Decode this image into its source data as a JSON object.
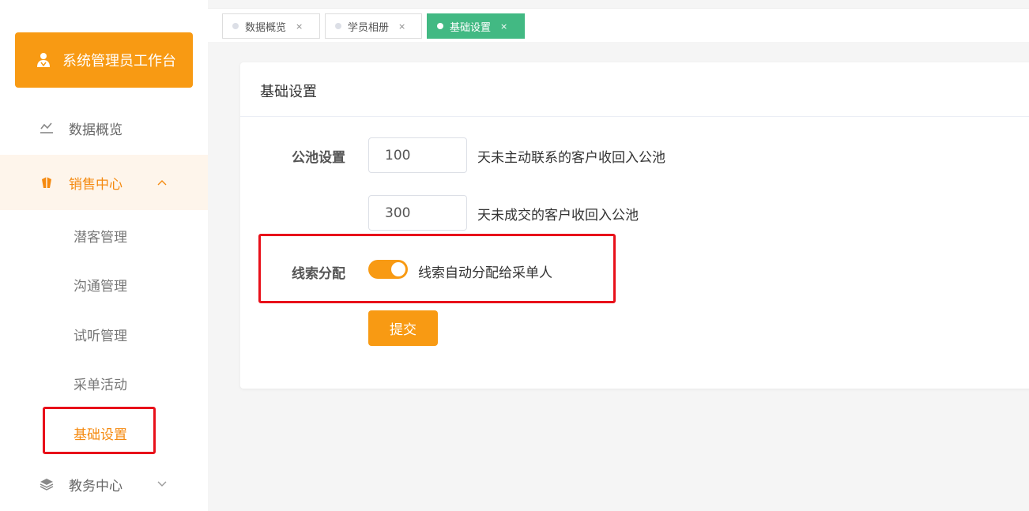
{
  "sidebar": {
    "workbench_label": "系统管理员工作台",
    "items": [
      {
        "label": "数据概览",
        "icon": "chart-line-icon"
      },
      {
        "label": "销售中心",
        "icon": "bag-icon"
      },
      {
        "label": "教务中心",
        "icon": "layers-icon"
      }
    ],
    "sales_subitems": [
      {
        "label": "潜客管理"
      },
      {
        "label": "沟通管理"
      },
      {
        "label": "试听管理"
      },
      {
        "label": "采单活动"
      },
      {
        "label": "基础设置"
      }
    ]
  },
  "tabs": [
    {
      "label": "数据概览",
      "close": "×"
    },
    {
      "label": "学员相册",
      "close": "×"
    },
    {
      "label": "基础设置",
      "close": "×"
    }
  ],
  "card": {
    "title": "基础设置",
    "pool_label": "公池设置",
    "pool_days_1": "100",
    "pool_suffix_1": "天未主动联系的客户收回入公池",
    "pool_days_2": "300",
    "pool_suffix_2": "天未成交的客户收回入公池",
    "lead_label": "线索分配",
    "lead_switch_on": true,
    "lead_desc": "线索自动分配给采单人",
    "submit_label": "提交"
  },
  "colors": {
    "accent": "#f89a13",
    "active_tab": "#42b983",
    "highlight_box": "#e8101a"
  }
}
